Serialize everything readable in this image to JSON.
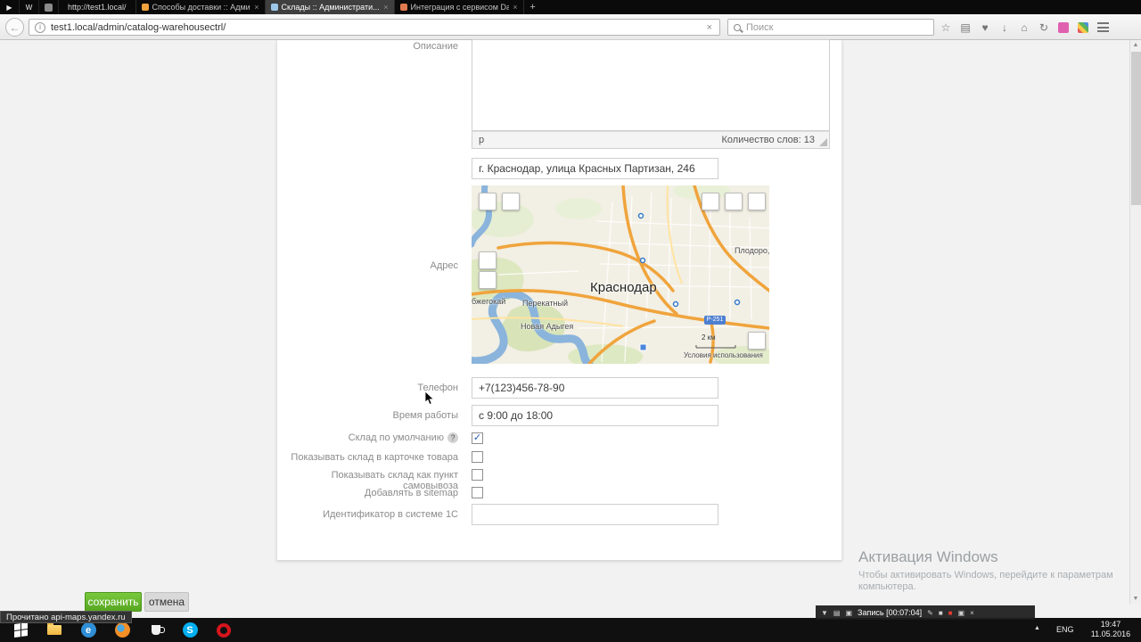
{
  "glyphs": {
    "play": "▶",
    "wiki": "W",
    "back": "←",
    "stop": "×",
    "plus": "+",
    "close": "×",
    "star": "☆",
    "clipboard": "▤",
    "heart": "♥",
    "download": "↓",
    "home": "⌂",
    "sync": "↻",
    "up": "▲",
    "down": "▼",
    "pencil": "✎",
    "wsquare": "■",
    "rsquare": "■",
    "camera": "▣",
    "info": "i",
    "ie": "e",
    "skype": "S"
  },
  "browser": {
    "app_tab": "http://test1.local/",
    "tabs": [
      {
        "label": "Способы доставки :: Админи..."
      },
      {
        "label": "Склады :: Администрати..."
      },
      {
        "label": "Интеграция с сервисом DaD..."
      }
    ],
    "url": "test1.local/admin/catalog-warehousectrl/",
    "search_placeholder": "Поиск",
    "status": "Прочитано api-maps.yandex.ru"
  },
  "form": {
    "description_label": "Описание",
    "editor_path": "p",
    "word_count": "Количество слов: 13",
    "address_label": "Адрес",
    "address_value": "г. Краснодар, улица Красных Партизан, 246",
    "phone_label": "Телефон",
    "phone_value": "+7(123)456-78-90",
    "hours_label": "Время работы",
    "hours_value": "с 9:00 до 18:00",
    "checkboxes": [
      {
        "label": "Склад по умолчанию",
        "help": "?",
        "mark": "✓"
      },
      {
        "label": "Показывать склад в карточке товара",
        "mark": ""
      },
      {
        "label": "Показывать склад как пункт самовывоза",
        "mark": ""
      },
      {
        "label": "Добавлять в sitemap",
        "mark": ""
      }
    ],
    "id1c_label": "Идентификатор в системе 1С",
    "id1c_value": "",
    "save": "сохранить",
    "cancel": "отмена"
  },
  "map": {
    "city": "Краснодар",
    "town_ne": "Плодоро,",
    "town_w": "бжегокай",
    "town_c": "Перекатный",
    "town_sw": "Новая Адыгея",
    "road_badge": "Р-251",
    "scale": "2 км",
    "terms": "Условия использования"
  },
  "watermark": {
    "title": "Активация Windows",
    "line1": "Чтобы активировать Windows, перейдите к параметрам",
    "line2": "компьютера."
  },
  "taskbar": {
    "recording": "Запись [00:07:04]",
    "lang": "ENG",
    "time": "19:47",
    "date": "11.05.2016"
  }
}
